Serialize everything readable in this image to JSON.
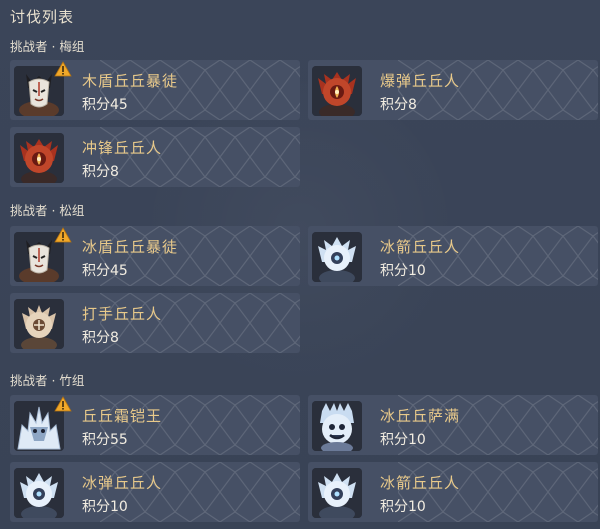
{
  "title": "讨伐列表",
  "groups": [
    {
      "label": "挑战者 · 梅组",
      "enemies": [
        {
          "name": "木盾丘丘暴徒",
          "score": "积分45",
          "warning": true,
          "icon": "mask-brute-icon"
        },
        {
          "name": "爆弹丘丘人",
          "score": "积分8",
          "warning": false,
          "icon": "red-hilichurl-icon"
        },
        {
          "name": "冲锋丘丘人",
          "score": "积分8",
          "warning": false,
          "icon": "red-hilichurl-icon"
        }
      ]
    },
    {
      "label": "挑战者 · 松组",
      "enemies": [
        {
          "name": "冰盾丘丘暴徒",
          "score": "积分45",
          "warning": true,
          "icon": "mask-brute-icon"
        },
        {
          "name": "冰箭丘丘人",
          "score": "积分10",
          "warning": false,
          "icon": "ice-hilichurl-icon"
        },
        {
          "name": "打手丘丘人",
          "score": "积分8",
          "warning": false,
          "icon": "tan-hilichurl-icon"
        }
      ]
    },
    {
      "label": "挑战者 · 竹组",
      "enemies": [
        {
          "name": "丘丘霜铠王",
          "score": "积分55",
          "warning": true,
          "icon": "frost-king-icon"
        },
        {
          "name": "冰丘丘萨满",
          "score": "积分10",
          "warning": false,
          "icon": "ice-shaman-icon"
        },
        {
          "name": "冰弹丘丘人",
          "score": "积分10",
          "warning": false,
          "icon": "ice-hilichurl-icon"
        },
        {
          "name": "冰箭丘丘人",
          "score": "积分10",
          "warning": false,
          "icon": "ice-hilichurl-icon"
        }
      ]
    }
  ],
  "colors": {
    "background": "#3a4459",
    "card": "#465065",
    "name": "#e8c98a",
    "warning": "#f0a82a"
  }
}
